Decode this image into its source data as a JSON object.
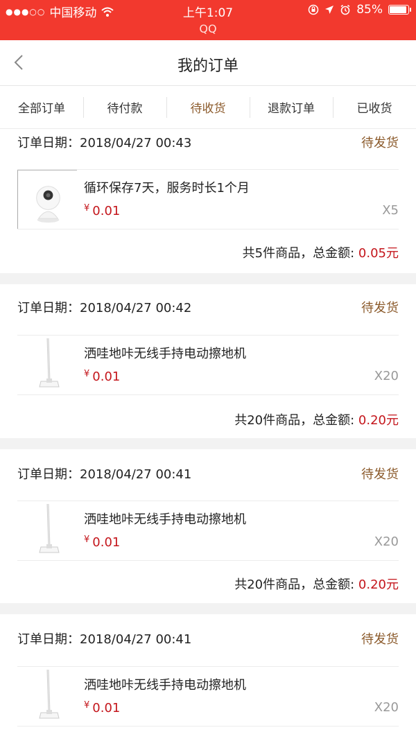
{
  "statusbar": {
    "carrier": "中国移动",
    "time": "上午1:07",
    "battery": "85%",
    "battery_level": 0.85,
    "app_label": "QQ"
  },
  "navbar": {
    "title": "我的订单"
  },
  "tabs": [
    "全部订单",
    "待付款",
    "待收货",
    "退款订单",
    "已收货"
  ],
  "active_tab": 2,
  "orders": [
    {
      "date_label": "订单日期：",
      "date": "2018/04/27 00:43",
      "status": "待发货",
      "product": "循环保存7天，服务时长1个月",
      "currency": "¥",
      "price": "0.01",
      "qty": "X5",
      "total_prefix": "共5件商品，总金额: ",
      "total_amount": "0.05元",
      "thumb": "camera-image"
    },
    {
      "date_label": "订单日期：",
      "date": "2018/04/27 00:42",
      "status": "待发货",
      "product": "洒哇地咔无线手持电动擦地机",
      "currency": "¥",
      "price": "0.01",
      "qty": "X20",
      "total_prefix": "共20件商品，总金额: ",
      "total_amount": "0.20元",
      "thumb": "mop-image"
    },
    {
      "date_label": "订单日期：",
      "date": "2018/04/27 00:41",
      "status": "待发货",
      "product": "洒哇地咔无线手持电动擦地机",
      "currency": "¥",
      "price": "0.01",
      "qty": "X20",
      "total_prefix": "共20件商品，总金额: ",
      "total_amount": "0.20元",
      "thumb": "mop-image"
    },
    {
      "date_label": "订单日期：",
      "date": "2018/04/27 00:41",
      "status": "待发货",
      "product": "洒哇地咔无线手持电动擦地机",
      "currency": "¥",
      "price": "0.01",
      "qty": "X20",
      "thumb": "mop-image"
    }
  ]
}
